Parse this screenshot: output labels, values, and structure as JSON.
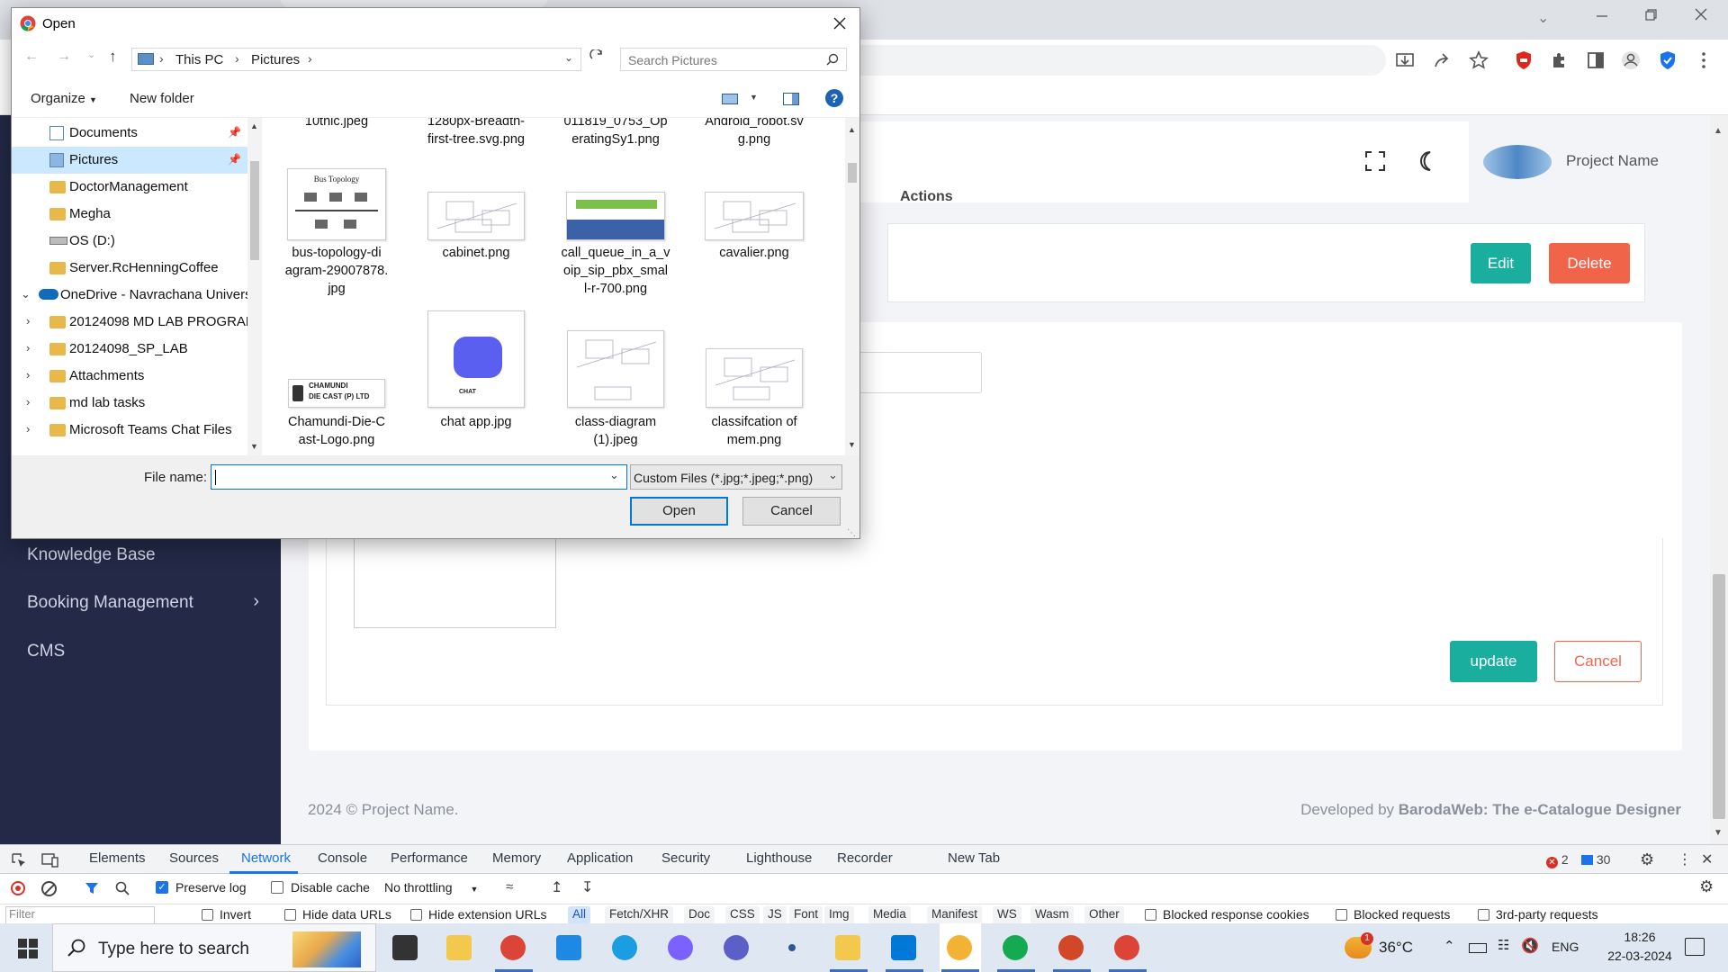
{
  "browser": {
    "window_controls": [
      "minimize",
      "restore",
      "close"
    ]
  },
  "page": {
    "header": {
      "project_name": "Project Name"
    },
    "table": {
      "actions_header": "Actions",
      "edit_label": "Edit",
      "delete_label": "Delete"
    },
    "sidebar": {
      "items": [
        "Knowledge Base",
        "Booking Management",
        "CMS"
      ]
    },
    "form": {
      "update_label": "update",
      "cancel_label": "Cancel"
    },
    "footer": {
      "copyright": "2024 © Project Name.",
      "developed_prefix": "Developed by ",
      "developer": "BarodaWeb: The e-Catalogue Designer"
    },
    "colors": {
      "sidebar": "#232946",
      "edit": "#1aae9f",
      "delete": "#f0654a",
      "update": "#1aae9f"
    }
  },
  "dialog": {
    "title": "Open",
    "breadcrumb": [
      "This PC",
      "Pictures"
    ],
    "search_placeholder": "Search Pictures",
    "organize_label": "Organize",
    "new_folder_label": "New folder",
    "nav_items": [
      {
        "label": "Documents",
        "type": "quick",
        "pinned": true
      },
      {
        "label": "Pictures",
        "type": "quick",
        "pinned": true,
        "selected": true
      },
      {
        "label": "DoctorManagement",
        "type": "folder"
      },
      {
        "label": "Megha",
        "type": "folder"
      },
      {
        "label": "OS (D:)",
        "type": "drive"
      },
      {
        "label": "Server.RcHenningCoffee",
        "type": "folder"
      },
      {
        "label": "OneDrive - Navrachana Univers",
        "type": "cloud"
      },
      {
        "label": "20124098 MD LAB PROGRAM",
        "type": "folder"
      },
      {
        "label": "20124098_SP_LAB",
        "type": "folder"
      },
      {
        "label": "Attachments",
        "type": "folder"
      },
      {
        "label": "md lab tasks",
        "type": "folder"
      },
      {
        "label": "Microsoft Teams Chat Files",
        "type": "folder"
      }
    ],
    "files": [
      [
        "10thlc.jpeg"
      ],
      [
        "1280px-Breadth-",
        "first-tree.svg.png"
      ],
      [
        "011819_0753_Op",
        "eratingSy1.png"
      ],
      [
        "Android_robot.sv",
        "g.png"
      ],
      [
        "bus-topology-di",
        "agram-29007878.",
        "jpg"
      ],
      [
        "cabinet.png"
      ],
      [
        "call_queue_in_a_v",
        "oip_sip_pbx_smal",
        "l-r-700.png"
      ],
      [
        "cavalier.png"
      ],
      [
        "Chamundi-Die-C",
        "ast-Logo.png"
      ],
      [
        "chat app.jpg"
      ],
      [
        "class-diagram",
        "(1).jpeg"
      ],
      [
        "classifcation of",
        "mem.png"
      ]
    ],
    "thumb_text": {
      "bus": "Bus Topology",
      "chamundi": "CHAMUNDI",
      "chamundi_sub": "DIE CAST (P) LTD",
      "chat": "CHAT"
    },
    "file_name_label": "File name:",
    "file_name_value": "",
    "filter_label": "Custom Files (*.jpg;*.jpeg;*.png)",
    "open_label": "Open",
    "cancel_label": "Cancel"
  },
  "devtools": {
    "tabs": [
      "Elements",
      "Sources",
      "Network",
      "Console",
      "Performance",
      "Memory",
      "Application",
      "Security",
      "Lighthouse",
      "Recorder",
      "New Tab"
    ],
    "active_tab": "Network",
    "errors": "2",
    "messages": "30",
    "preserve_log": "Preserve log",
    "disable_cache": "Disable cache",
    "throttling": "No throttling",
    "filter_placeholder": "Filter",
    "filter_options": [
      "Invert",
      "Hide data URLs",
      "Hide extension URLs"
    ],
    "types": [
      "All",
      "Fetch/XHR",
      "Doc",
      "CSS",
      "JS",
      "Font",
      "Img",
      "Media",
      "Manifest",
      "WS",
      "Wasm",
      "Other"
    ],
    "extra_filters": [
      "Blocked response cookies",
      "Blocked requests",
      "3rd-party requests"
    ]
  },
  "taskbar": {
    "search_placeholder": "Type here to search",
    "temperature": "36°C",
    "language": "ENG",
    "time": "18:26",
    "date": "22-03-2024",
    "weather_badge": "1"
  }
}
